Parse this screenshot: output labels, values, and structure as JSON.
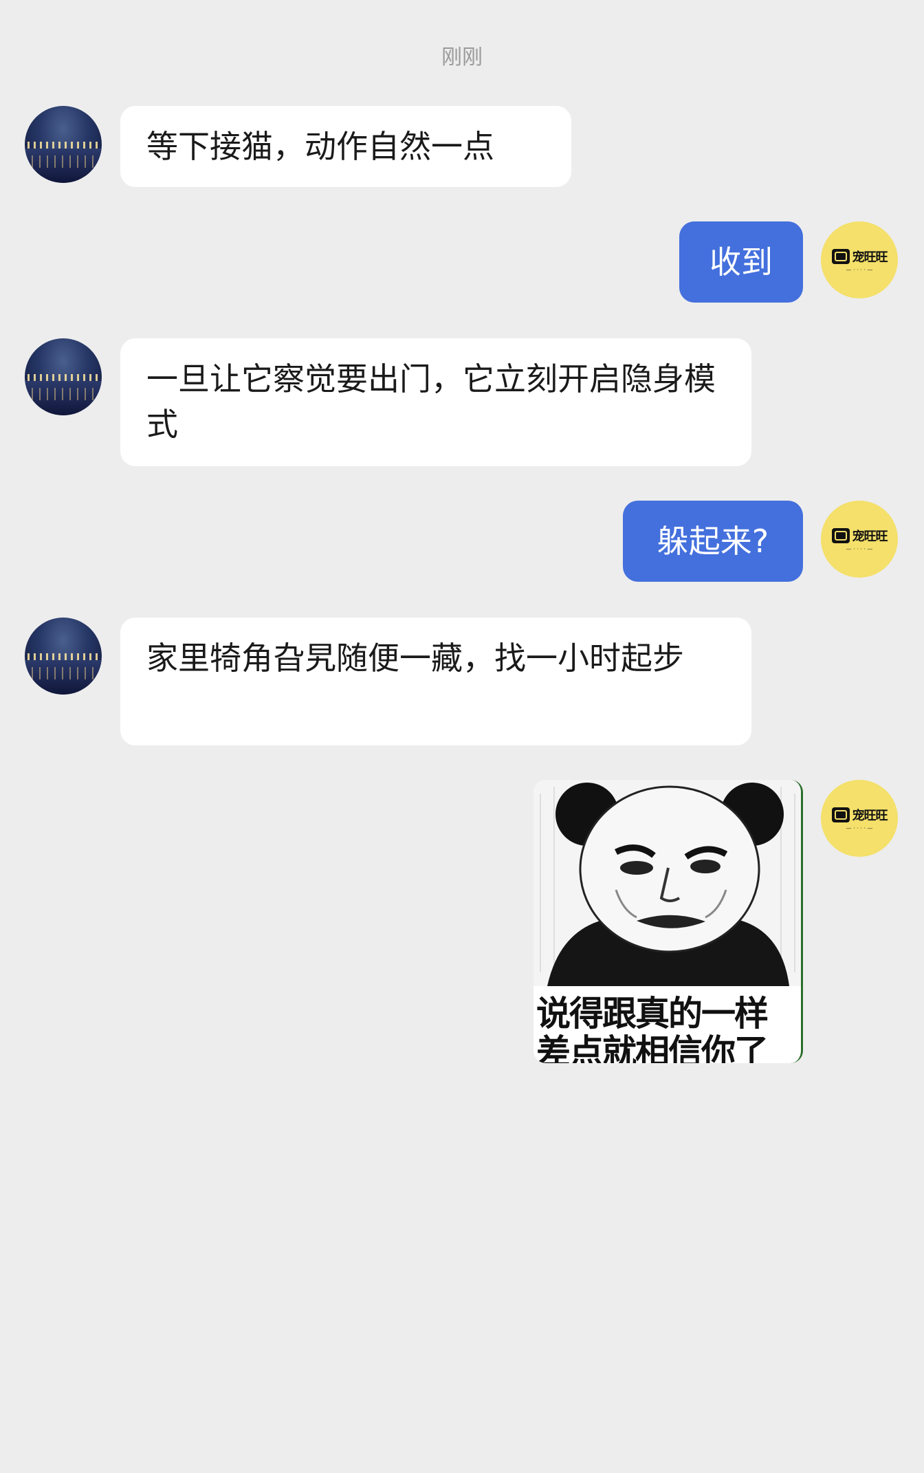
{
  "timestamp": "刚刚",
  "messages": [
    {
      "side": "left",
      "text": "等下接猫，动作自然一点"
    },
    {
      "side": "right",
      "text": "收到"
    },
    {
      "side": "left",
      "text": "一旦让它察觉要出门，它立刻开启隐身模式"
    },
    {
      "side": "right",
      "text": "躲起来?"
    },
    {
      "side": "left",
      "text": "家里犄角旮旯随便一藏，找一小时起步"
    }
  ],
  "sticker": {
    "line1": "说得跟真的一样",
    "line2": "差点就相信你了"
  },
  "avatars": {
    "friend": "night-harbor-avatar",
    "self": "brand-logo-avatar",
    "self_logo_text": "宠旺旺"
  },
  "colors": {
    "background": "#ededed",
    "incoming_bubble": "#ffffff",
    "outgoing_bubble": "#4470dd",
    "self_avatar": "#f4e06a"
  }
}
